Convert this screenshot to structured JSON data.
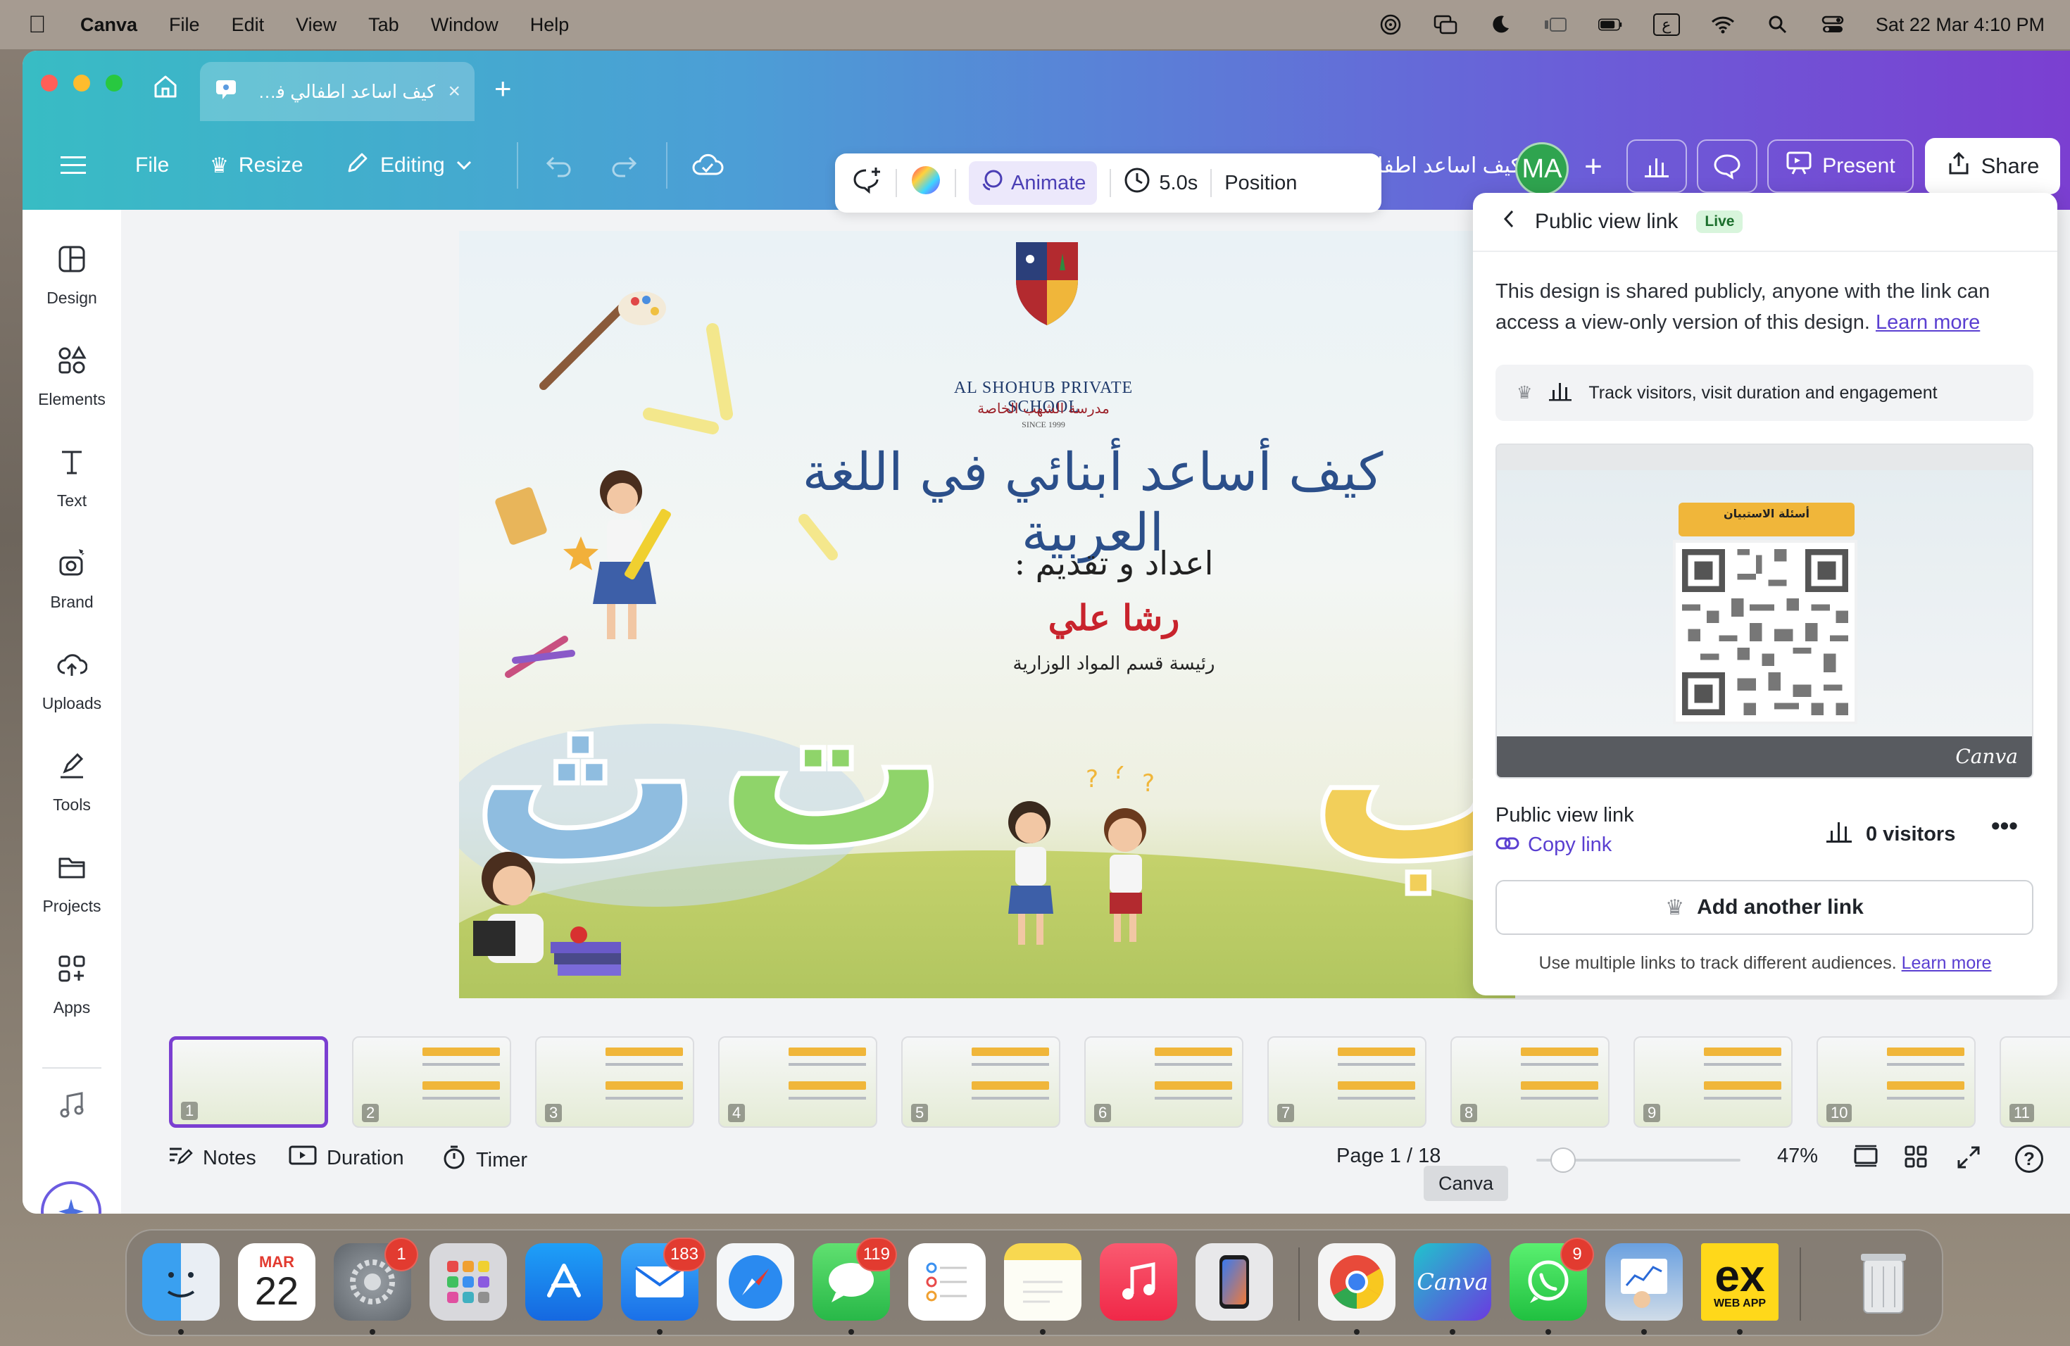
{
  "menubar": {
    "app": "Canva",
    "items": [
      "File",
      "Edit",
      "View",
      "Tab",
      "Window",
      "Help"
    ],
    "datetime": "Sat 22 Mar  4:10 PM",
    "keyboard_indicator": "ع"
  },
  "browser": {
    "tab_title": "كيف اساعد اطفالي في اللغة العربية...",
    "tab_close": "×",
    "new_tab": "+"
  },
  "toolbar": {
    "file": "File",
    "resize": "Resize",
    "editing": "Editing",
    "doc_title": "كيف اساعد اطفالي في اللغة العربية",
    "avatar": "MA",
    "present": "Present",
    "share": "Share"
  },
  "sidebar": {
    "items": [
      {
        "label": "Design",
        "icon": "layout-icon"
      },
      {
        "label": "Elements",
        "icon": "shapes-icon"
      },
      {
        "label": "Text",
        "icon": "text-icon"
      },
      {
        "label": "Brand",
        "icon": "brand-icon"
      },
      {
        "label": "Uploads",
        "icon": "cloud-upload-icon"
      },
      {
        "label": "Tools",
        "icon": "pen-tool-icon"
      },
      {
        "label": "Projects",
        "icon": "folder-icon"
      },
      {
        "label": "Apps",
        "icon": "apps-grid-icon"
      }
    ]
  },
  "floatbar": {
    "animate": "Animate",
    "duration": "5.0s",
    "position": "Position"
  },
  "slide": {
    "school_en": "AL SHOHUB PRIVATE SCHOOL",
    "school_ar": "مدرسة الشهب الخاصة",
    "school_since": "SINCE 1999",
    "title": "كيف أساعد أبنائي في اللغة العربية",
    "subtitle": "اعداد و تقديم :",
    "presenter": "رشا علي",
    "role": "رئيسة قسم المواد الوزارية",
    "letters": [
      "ث",
      "ت",
      "ب"
    ]
  },
  "share_panel": {
    "header": "Public view link",
    "live": "Live",
    "description": "This design is shared publicly, anyone with the link can access a view-only version of this design.",
    "learn_more": "Learn more",
    "track": "Track visitors, visit duration and engagement",
    "preview_badge": "أسئلة الاستبيان",
    "preview_brand": "Canva",
    "link_label": "Public view link",
    "copy_link": "Copy link",
    "visitors": "0 visitors",
    "more": "•••",
    "add_link": "Add another link",
    "footer": "Use multiple links to track different audiences.",
    "footer_link": "Learn more"
  },
  "filmstrip": {
    "pages": [
      "1",
      "2",
      "3",
      "4",
      "5",
      "6",
      "7",
      "8",
      "9",
      "10",
      "11"
    ],
    "active": 1
  },
  "statusbar": {
    "notes": "Notes",
    "duration": "Duration",
    "timer": "Timer",
    "page": "Page 1 / 18",
    "tooltip": "Canva",
    "zoom": "47%",
    "zoom_level": 0.13,
    "help": "?"
  },
  "dock": {
    "calendar_month": "MAR",
    "calendar_day": "22",
    "badges": {
      "settings": "1",
      "mail": "183",
      "messages": "119",
      "whatsapp": "9"
    },
    "canva_label": "Canva",
    "ex_label": "ex",
    "ex_sub": "WEB APP"
  },
  "colors": {
    "accent": "#7b3fd1",
    "gradient_start": "#38bcc4",
    "gradient_end": "#7b3fd1",
    "live_green": "#d8f5dc",
    "link_purple": "#5a3fd1"
  }
}
